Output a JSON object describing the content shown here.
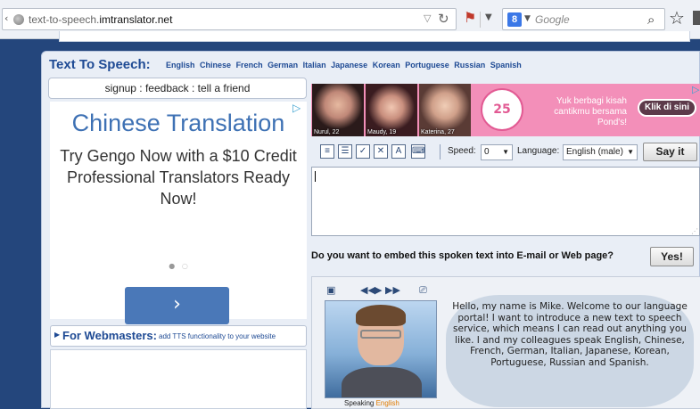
{
  "browser": {
    "url_prefix": "text-to-speech.",
    "url_domain": "imtranslator.net",
    "search_placeholder": "Google",
    "search_engine_badge": "8"
  },
  "page": {
    "title": "Text To Speech:",
    "languages": [
      "English",
      "Chinese",
      "French",
      "German",
      "Italian",
      "Japanese",
      "Korean",
      "Portuguese",
      "Russian",
      "Spanish"
    ],
    "account_links": "signup : feedback : tell a friend"
  },
  "ad": {
    "title": "Chinese Translation",
    "body": "Try Gengo Now with a $10 Credit Professional Translators Ready Now!",
    "button_glyph": "›"
  },
  "webmasters": {
    "title": "For Webmasters:",
    "subtitle": "add TTS functionality to your website"
  },
  "banner": {
    "photos": [
      {
        "caption": "Nurul, 22"
      },
      {
        "caption": "Maudy, 19"
      },
      {
        "caption": "Katerina, 27"
      }
    ],
    "logo_text": "25",
    "text": "Yuk berbagi kisah cantikmu bersama Pond's!",
    "button_label": "Klik di sini"
  },
  "toolbar": {
    "speed_label": "Speed:",
    "speed_value": "0",
    "language_label": "Language:",
    "language_value": "English (male)",
    "say_button": "Say it"
  },
  "tts_input": {
    "value": ""
  },
  "embed": {
    "question": "Do you want to embed this spoken text into E-mail or Web page?",
    "yes_button": "Yes!"
  },
  "avatar": {
    "speaking_label": "Speaking",
    "speaking_language": "English",
    "speech": "Hello, my name is Mike. Welcome to our language portal! I want to introduce a new text to speech service, which means I can read out anything you like. I and my colleagues speak English, Chinese, French, German, Italian, Japanese, Korean, Portuguese, Russian and Spanish."
  },
  "colors": {
    "page_background": "#24467c",
    "title_blue": "#1e4a94",
    "ad_button": "#4a78b8",
    "banner_pink": "#f38fb9"
  }
}
